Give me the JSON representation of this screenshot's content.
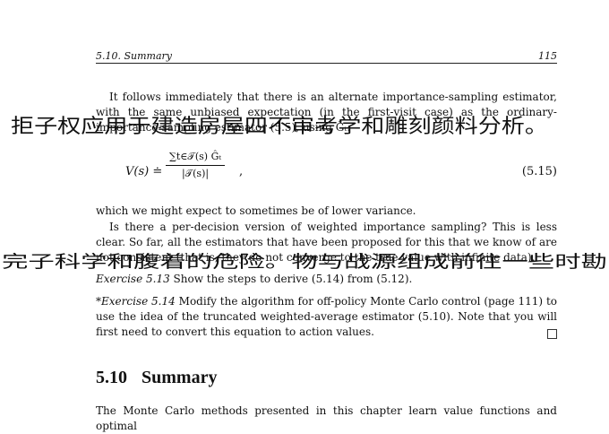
{
  "header": {
    "section": "5.10.  Summary",
    "page_number": "115"
  },
  "para1": "It follows immediately that there is an alternate importance-sampling estimator, with the same unbiased expectation (in the first-visit case) as the ordinary-importance-sampling estimator (5.5), using Ĝₜ:",
  "equation": {
    "lhs": "V(s) ≐",
    "numerator": "∑t∈𝒯(s) Ĝₜ",
    "denominator": "|𝒯(s)|",
    "comma": ",",
    "label": "(5.15)"
  },
  "para2": "which we might expect to sometimes be of lower variance.",
  "para3": "Is there a per-decision version of weighted importance sampling? This is less clear. So far, all the estimators that have been proposed for this that we know of are not consistent (that is, they do not converge to the true value with infinite data).",
  "exercise_5_13": {
    "label": "Exercise 5.13",
    "text": "Show the steps to derive (5.14) from (5.12)."
  },
  "exercise_5_14": {
    "label": "*Exercise 5.14",
    "text": "Modify the algorithm for off-policy Monte Carlo control (page 111) to use the idea of the truncated weighted-average estimator (5.10). Note that you will first need to convert this equation to action values."
  },
  "section": {
    "number": "5.10",
    "title": "Summary"
  },
  "para_summary": "The Monte Carlo methods presented in this chapter learn value functions and optimal",
  "handwriting": {
    "line1": "拒子权应用于建造房屋四不审考学和雕刻颜料分析。",
    "line2": "完子科学和腹着的危险。物与战源组成前往一些时勘"
  }
}
